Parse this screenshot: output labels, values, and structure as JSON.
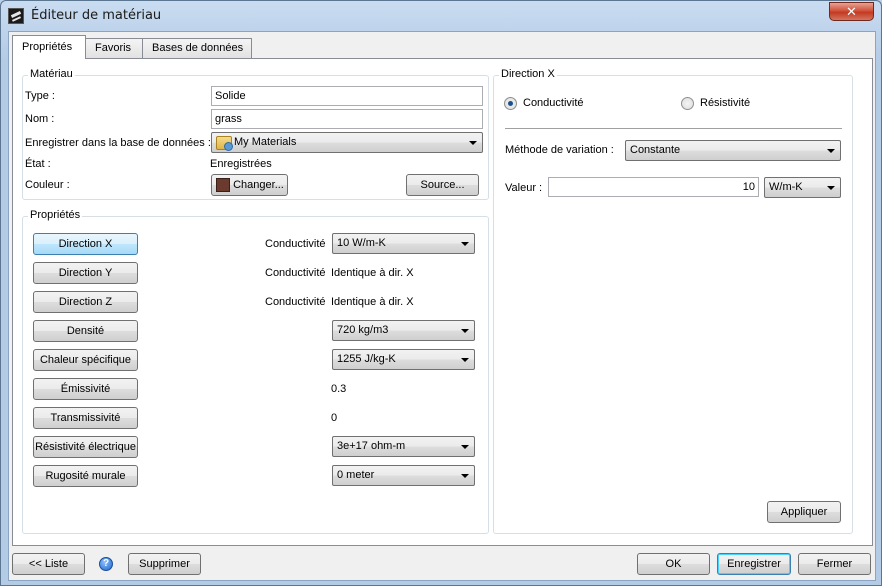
{
  "window": {
    "title": "Éditeur de matériau",
    "close_label": "✕"
  },
  "tabs": [
    {
      "label": "Propriétés",
      "active": true
    },
    {
      "label": "Favoris"
    },
    {
      "label": "Bases de données"
    }
  ],
  "material": {
    "group_title": "Matériau",
    "type_label": "Type :",
    "type_value": "Solide",
    "name_label": "Nom :",
    "name_value": "grass",
    "save_db_label": "Enregistrer dans la base de données :",
    "save_db_value": "My Materials",
    "state_label": "État :",
    "state_value": "Enregistrées",
    "color_label": "Couleur :",
    "color_hex": "#6b3a2e",
    "change_button": "Changer...",
    "source_button": "Source..."
  },
  "properties": {
    "group_title": "Propriétés",
    "rows": [
      {
        "button": "Direction X",
        "label": "Conductivité",
        "value": "10 W/m-K",
        "kind": "combo",
        "selected": true
      },
      {
        "button": "Direction Y",
        "label": "Conductivité",
        "value": "Identique à dir. X",
        "kind": "text"
      },
      {
        "button": "Direction Z",
        "label": "Conductivité",
        "value": "Identique à dir. X",
        "kind": "text"
      },
      {
        "button": "Densité",
        "label": "",
        "value": "720 kg/m3",
        "kind": "combo"
      },
      {
        "button": "Chaleur spécifique",
        "label": "",
        "value": "1255 J/kg-K",
        "kind": "combo"
      },
      {
        "button": "Émissivité",
        "label": "",
        "value": "0.3",
        "kind": "text"
      },
      {
        "button": "Transmissivité",
        "label": "",
        "value": "0",
        "kind": "text"
      },
      {
        "button": "Résistivité électrique",
        "label": "",
        "value": "3e+17 ohm-m",
        "kind": "combo"
      },
      {
        "button": "Rugosité murale",
        "label": "",
        "value": "0 meter",
        "kind": "combo"
      }
    ]
  },
  "direction": {
    "group_title": "Direction X",
    "radio_conductivity": "Conductivité",
    "radio_resistivity": "Résistivité",
    "method_label": "Méthode de variation :",
    "method_value": "Constante",
    "value_label": "Valeur :",
    "value": "10",
    "unit": "W/m-K",
    "apply_button": "Appliquer"
  },
  "footer": {
    "list_button": "<< Liste",
    "help_icon_glyph": "?",
    "delete_button": "Supprimer",
    "ok_button": "OK",
    "save_button": "Enregistrer",
    "close_button": "Fermer"
  }
}
